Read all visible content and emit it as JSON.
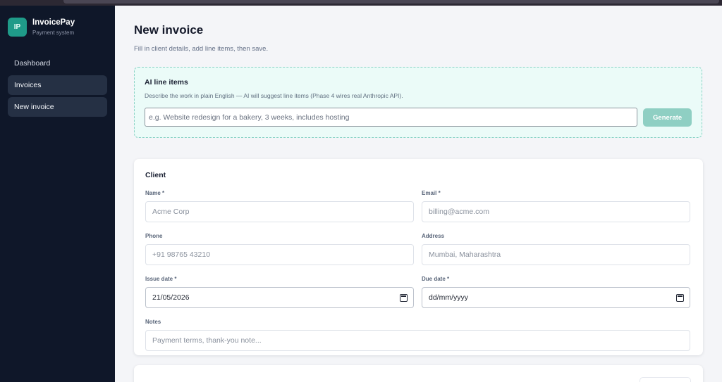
{
  "brand": {
    "logo": "IP",
    "name": "InvoicePay",
    "subtitle": "Payment system"
  },
  "sidebar": {
    "items": [
      {
        "label": "Dashboard",
        "active": false
      },
      {
        "label": "Invoices",
        "active": true
      },
      {
        "label": "New invoice",
        "active": true
      }
    ]
  },
  "page": {
    "title": "New invoice",
    "subtitle": "Fill in client details, add line items, then save."
  },
  "ai": {
    "title": "AI line items",
    "description": "Describe the work in plain English — AI will suggest line items (Phase 4 wires real Anthropic API).",
    "placeholder": "e.g. Website redesign for a bakery, 3 weeks, includes hosting",
    "button": "Generate"
  },
  "client": {
    "title": "Client",
    "name": {
      "label": "Name *",
      "placeholder": "Acme Corp"
    },
    "email": {
      "label": "Email *",
      "placeholder": "billing@acme.com"
    },
    "phone": {
      "label": "Phone",
      "placeholder": "+91 98765 43210"
    },
    "address": {
      "label": "Address",
      "placeholder": "Mumbai, Maharashtra"
    },
    "issue_date": {
      "label": "Issue date *",
      "value": "21/05/2026"
    },
    "due_date": {
      "label": "Due date *",
      "value": "dd/mm/yyyy"
    },
    "notes": {
      "label": "Notes",
      "placeholder": "Payment terms, thank-you note..."
    }
  },
  "colors": {
    "sidebar": "#0f1729",
    "accent": "#1f9b89",
    "button": "#8fcfc3",
    "ai_panel": "#ebfbf8"
  }
}
